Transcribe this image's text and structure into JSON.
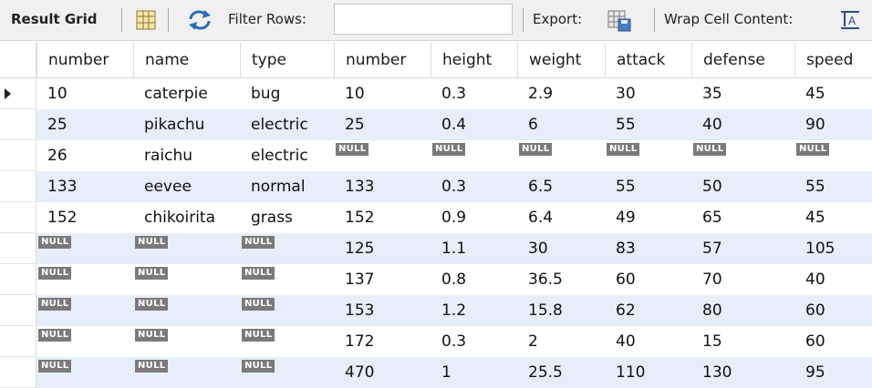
{
  "toolbar": {
    "title": "Result Grid",
    "filter_label": "Filter Rows:",
    "filter_value": "",
    "export_label": "Export:",
    "wrap_label": "Wrap Cell Content:"
  },
  "icons": [
    "grid-view-icon",
    "refresh-icon",
    "export-icon",
    "wrap-text-icon"
  ],
  "columns": [
    "number",
    "name",
    "type",
    "number",
    "height",
    "weight",
    "attack",
    "defense",
    "speed"
  ],
  "null_label": "NULL",
  "rows": [
    [
      "10",
      "caterpie",
      "bug",
      "10",
      "0.3",
      "2.9",
      "30",
      "35",
      "45"
    ],
    [
      "25",
      "pikachu",
      "electric",
      "25",
      "0.4",
      "6",
      "55",
      "40",
      "90"
    ],
    [
      "26",
      "raichu",
      "electric",
      null,
      null,
      null,
      null,
      null,
      null
    ],
    [
      "133",
      "eevee",
      "normal",
      "133",
      "0.3",
      "6.5",
      "55",
      "50",
      "55"
    ],
    [
      "152",
      "chikoirita",
      "grass",
      "152",
      "0.9",
      "6.4",
      "49",
      "65",
      "45"
    ],
    [
      null,
      null,
      null,
      "125",
      "1.1",
      "30",
      "83",
      "57",
      "105"
    ],
    [
      null,
      null,
      null,
      "137",
      "0.8",
      "36.5",
      "60",
      "70",
      "40"
    ],
    [
      null,
      null,
      null,
      "153",
      "1.2",
      "15.8",
      "62",
      "80",
      "60"
    ],
    [
      null,
      null,
      null,
      "172",
      "0.3",
      "2",
      "40",
      "15",
      "60"
    ],
    [
      null,
      null,
      null,
      "470",
      "1",
      "25.5",
      "110",
      "130",
      "95"
    ]
  ],
  "selected_row_index": 0,
  "colors": {
    "row_alt": "#e6eef9",
    "null_badge": "#7a7a7a"
  }
}
